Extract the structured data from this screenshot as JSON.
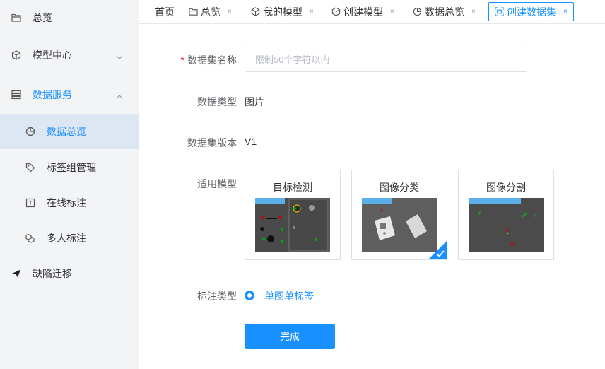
{
  "sidebar": {
    "items": [
      {
        "label": "总览",
        "icon": "folder-open-icon"
      },
      {
        "label": "模型中心",
        "icon": "cube-icon",
        "expanded": false
      },
      {
        "label": "数据服务",
        "icon": "database-icon",
        "expanded": true
      },
      {
        "label": "数据总览",
        "icon": "pie-chart-icon",
        "selected": true
      },
      {
        "label": "标签组管理",
        "icon": "tag-icon"
      },
      {
        "label": "在线标注",
        "icon": "text-box-icon"
      },
      {
        "label": "多人标注",
        "icon": "boxes-icon"
      },
      {
        "label": "缺陷迁移",
        "icon": "send-icon"
      }
    ]
  },
  "tabs": [
    {
      "label": "首页",
      "icon": "",
      "closable": false
    },
    {
      "label": "总览",
      "icon": "folder-open-icon",
      "closable": true
    },
    {
      "label": "我的模型",
      "icon": "cube-icon",
      "closable": true
    },
    {
      "label": "创建模型",
      "icon": "cube-outline-icon",
      "closable": true
    },
    {
      "label": "数据总览",
      "icon": "pie-chart-icon",
      "closable": true
    },
    {
      "label": "创建数据集",
      "icon": "scan-icon",
      "closable": true,
      "active": true
    }
  ],
  "tab_close_glyph": "×",
  "form": {
    "required_mark": "*",
    "name_label": "数据集名称",
    "name_placeholder": "限制50个字符以内",
    "name_value": "",
    "type_label": "数据类型",
    "type_value": "图片",
    "version_label": "数据集版本",
    "version_value": "V1",
    "model_label": "适用模型",
    "models": [
      {
        "title": "目标检测",
        "selected": false
      },
      {
        "title": "图像分类",
        "selected": true
      },
      {
        "title": "图像分割",
        "selected": false
      }
    ],
    "annotation_label": "标注类型",
    "annotation_option": "单图单标签",
    "submit_label": "完成"
  },
  "colors": {
    "accent": "#1890ff",
    "required": "#f5222d",
    "sidebar_bg": "#f3f4f6",
    "selected_bg": "#dde6f3"
  }
}
